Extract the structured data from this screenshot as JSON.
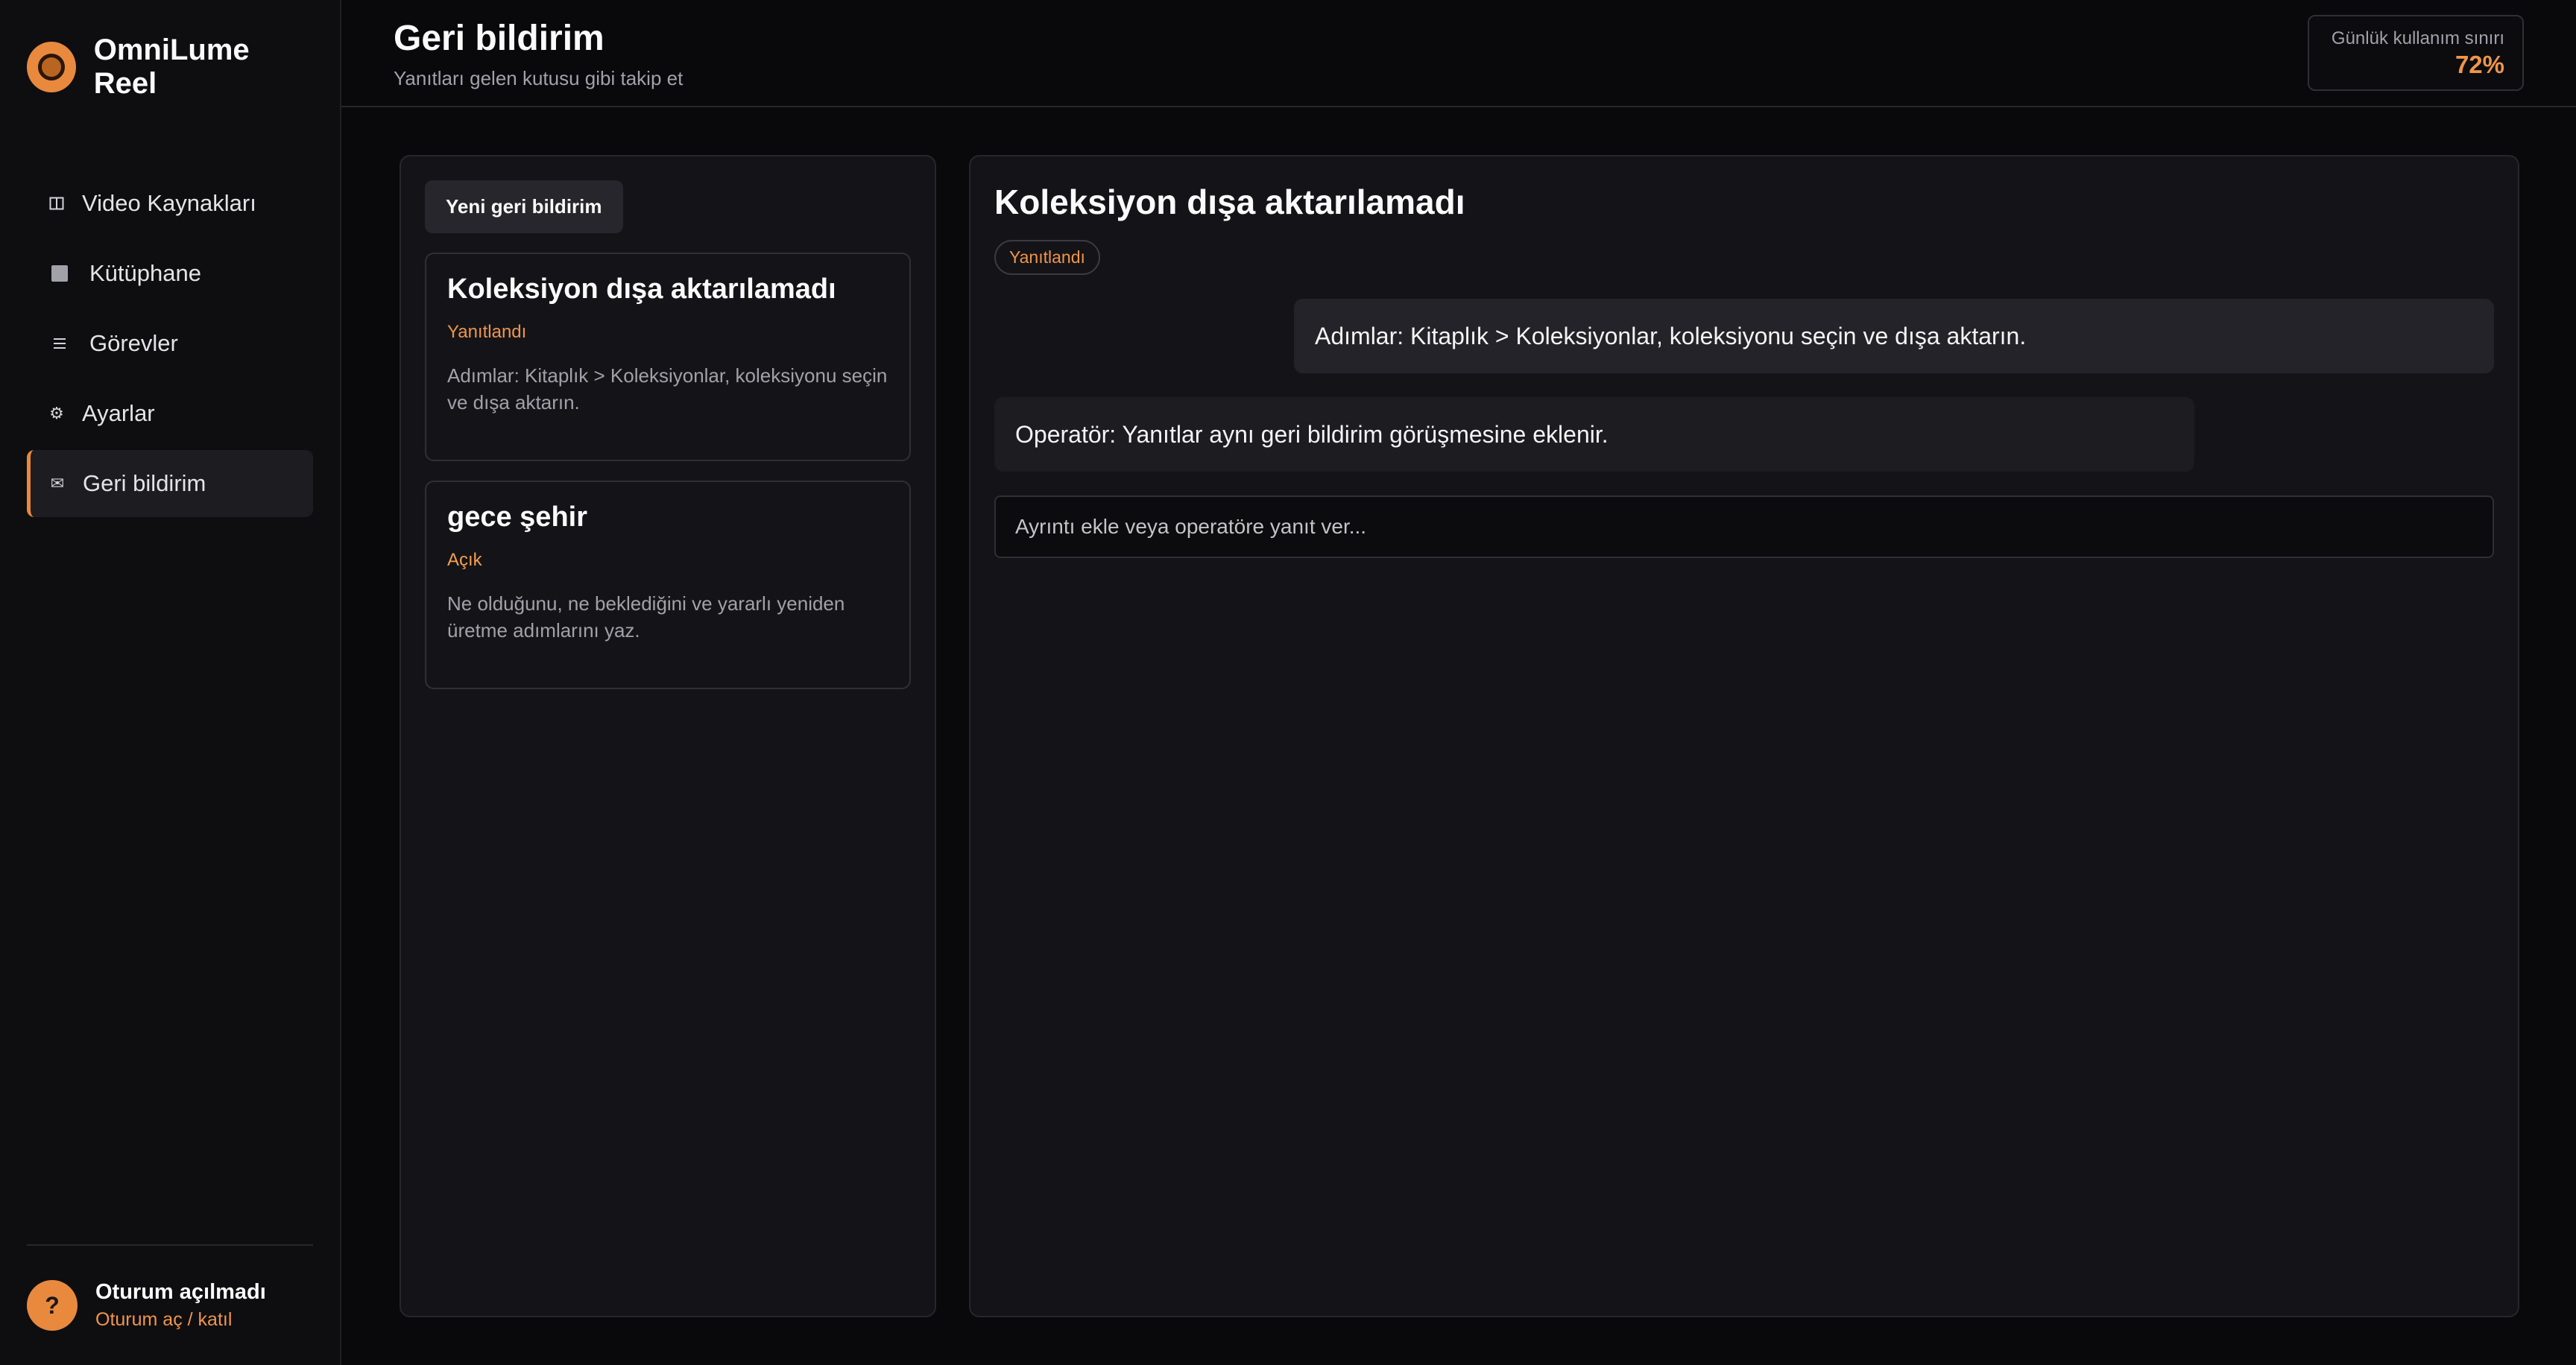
{
  "app": {
    "name": "OmniLume Reel"
  },
  "sidebar": {
    "items": [
      {
        "label": "Video Kaynakları",
        "icon": "columns-icon"
      },
      {
        "label": "Kütüphane",
        "icon": "square-icon"
      },
      {
        "label": "Görevler",
        "icon": "list-icon"
      },
      {
        "label": "Ayarlar",
        "icon": "gear-icon"
      },
      {
        "label": "Geri bildirim",
        "icon": "envelope-icon",
        "active": true
      }
    ],
    "footer": {
      "avatar": "?",
      "title": "Oturum açılmadı",
      "link": "Oturum aç / katıl"
    }
  },
  "header": {
    "title": "Geri bildirim",
    "subtitle": "Yanıtları gelen kutusu gibi takip et",
    "usage": {
      "label": "Günlük kullanım sınırı",
      "value": "72%"
    }
  },
  "feedback_list": {
    "new_button": "Yeni geri bildirim",
    "items": [
      {
        "title": "Koleksiyon dışa aktarılamadı",
        "status": "Yanıtlandı",
        "description": "Adımlar: Kitaplık > Koleksiyonlar, koleksiyonu seçin ve dışa aktarın."
      },
      {
        "title": "gece şehir",
        "status": "Açık",
        "description": "Ne olduğunu, ne beklediğini ve yararlı yeniden üretme adımlarını yaz."
      }
    ]
  },
  "detail": {
    "title": "Koleksiyon dışa aktarılamadı",
    "status": "Yanıtlandı",
    "messages": [
      {
        "from": "user",
        "text": "Adımlar: Kitaplık > Koleksiyonlar, koleksiyonu seçin ve dışa aktarın."
      },
      {
        "from": "operator",
        "text": "Operatör: Yanıtlar aynı geri bildirim görüşmesine eklenir."
      }
    ],
    "reply_placeholder": "Ayrıntı ekle veya operatöre yanıt ver..."
  },
  "colors": {
    "accent": "#e8893e",
    "background": "#09090b",
    "panel": "#141418"
  }
}
